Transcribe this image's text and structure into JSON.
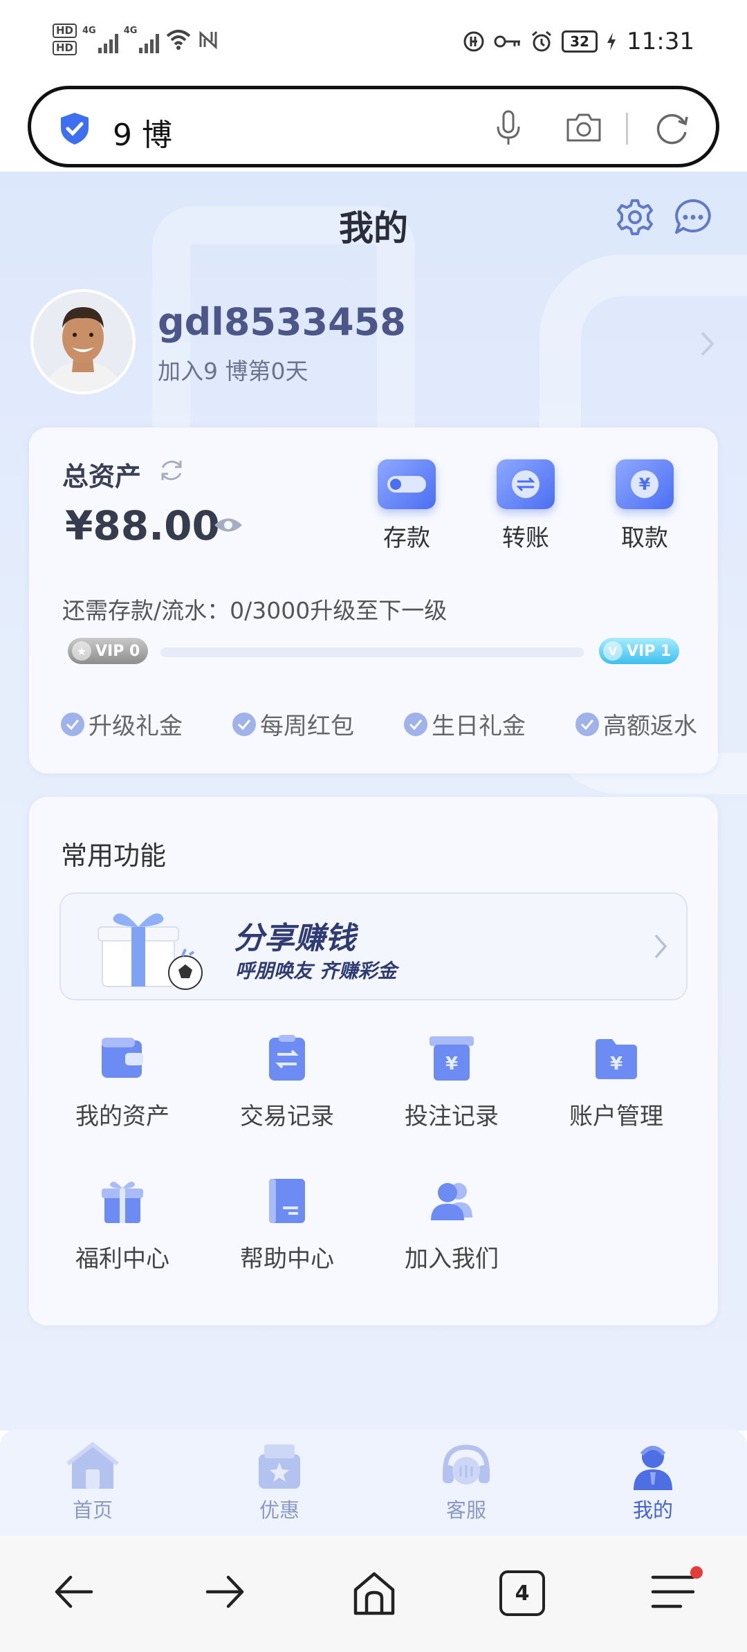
{
  "status_bar": {
    "hd1": "HD",
    "hd2": "HD",
    "net1": "4G",
    "net2": "4G",
    "battery": "32",
    "time": "11:31"
  },
  "browser": {
    "url_text": "9 博",
    "tab_count": "4"
  },
  "header": {
    "title": "我的"
  },
  "profile": {
    "username": "gdl8533458",
    "joined": "加入9 博第0天"
  },
  "assets": {
    "label": "总资产",
    "balance": "¥88.00",
    "actions": [
      {
        "label": "存款",
        "icon": "deposit-card-icon"
      },
      {
        "label": "转账",
        "icon": "transfer-icon"
      },
      {
        "label": "取款",
        "icon": "withdraw-yen-icon"
      }
    ],
    "upgrade_text": "还需存款/流水：0/3000升级至下一级",
    "vip_current": "VIP 0",
    "vip_next": "VIP 1",
    "progress": 0,
    "perks": [
      "升级礼金",
      "每周红包",
      "生日礼金",
      "高额返水"
    ]
  },
  "functions": {
    "title": "常用功能",
    "banner_title": "分享赚钱",
    "banner_sub": "呼朋唤友 齐赚彩金",
    "items": [
      {
        "label": "我的资产",
        "icon": "wallet-icon"
      },
      {
        "label": "交易记录",
        "icon": "transaction-record-icon"
      },
      {
        "label": "投注记录",
        "icon": "bet-record-icon"
      },
      {
        "label": "账户管理",
        "icon": "account-folder-icon"
      },
      {
        "label": "福利中心",
        "icon": "gift-icon"
      },
      {
        "label": "帮助中心",
        "icon": "help-book-icon"
      },
      {
        "label": "加入我们",
        "icon": "join-us-icon"
      }
    ]
  },
  "tabs": [
    {
      "label": "首页",
      "icon": "home-icon",
      "active": false
    },
    {
      "label": "优惠",
      "icon": "promo-icon",
      "active": false
    },
    {
      "label": "客服",
      "icon": "headset-icon",
      "active": false
    },
    {
      "label": "我的",
      "icon": "profile-icon",
      "active": true
    }
  ],
  "colors": {
    "accent": "#4b6ff2",
    "text_primary": "#2a2d3a",
    "username": "#4c5689",
    "background": "#e6eefc",
    "notification": "#e63b3b"
  }
}
